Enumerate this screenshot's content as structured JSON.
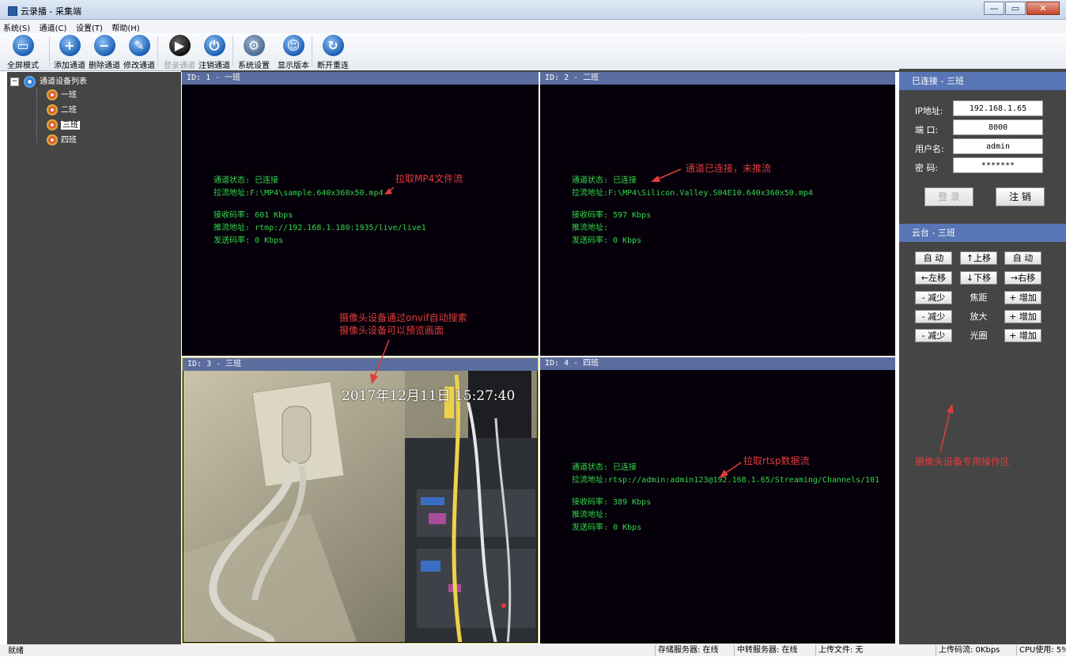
{
  "window": {
    "title": "云录播 - 采集端",
    "buttons": {
      "minimize": "—",
      "maximize": "▭",
      "close": "✕"
    }
  },
  "menu": [
    "系统(S)",
    "通道(C)",
    "设置(T)",
    "帮助(H)"
  ],
  "toolbar": [
    {
      "label": "全屏模式",
      "icon": "monitor-icon",
      "enabled": true
    },
    {
      "label": "添加通道",
      "icon": "plus-circle-icon",
      "enabled": true
    },
    {
      "label": "删除通道",
      "icon": "minus-circle-icon",
      "enabled": true
    },
    {
      "label": "修改通道",
      "icon": "edit-circle-icon",
      "enabled": true
    },
    {
      "label": "登录通道",
      "icon": "play-circle-icon",
      "enabled": false
    },
    {
      "label": "注销通道",
      "icon": "power-icon",
      "enabled": true
    },
    {
      "label": "系统设置",
      "icon": "gear-icon",
      "enabled": true
    },
    {
      "label": "显示版本",
      "icon": "user-icon",
      "enabled": true
    },
    {
      "label": "断开重连",
      "icon": "refresh-icon",
      "enabled": true
    }
  ],
  "tree": {
    "root_expander": "−",
    "root": "通道设备列表",
    "items": [
      "一班",
      "二班",
      "三班",
      "四班"
    ],
    "selected_index": 2
  },
  "panels": [
    {
      "header": "ID: 1 - 一班",
      "status_label": "通道状态:",
      "status": "已连接",
      "pull_label": "拉流地址:",
      "pull": "F:\\MP4\\sample.640x360x50.mp4",
      "recv_label": "接收码率:",
      "recv": "601 Kbps",
      "push_label": "推流地址:",
      "push": "rtmp://192.168.1.180:1935/live/live1",
      "send_label": "发送码率:",
      "send": "0 Kbps"
    },
    {
      "header": "ID: 2 - 二班",
      "status_label": "通道状态:",
      "status": "已连接",
      "pull_label": "拉流地址:",
      "pull": "F:\\MP4\\Silicon.Valley.S04E10.640x360x50.mp4",
      "recv_label": "接收码率:",
      "recv": "597 Kbps",
      "push_label": "推流地址:",
      "push": "",
      "send_label": "发送码率:",
      "send": "0 Kbps"
    },
    {
      "header": "ID: 3 - 三班",
      "timestamp": "2017年12月11日 15:27:40"
    },
    {
      "header": "ID: 4 - 四班",
      "status_label": "通道状态:",
      "status": "已连接",
      "pull_label": "拉流地址:",
      "pull": "rtsp://admin:admin123@192.168.1.65/Streaming/Channels/101",
      "recv_label": "接收码率:",
      "recv": "389 Kbps",
      "push_label": "推流地址:",
      "push": "",
      "send_label": "发送码率:",
      "send": "0 Kbps"
    }
  ],
  "annotations": {
    "mp4": "拉取MP4文件流",
    "connected": "通道已连接，未推流",
    "onvif_line1": "摄像头设备通过onvif自动搜索",
    "onvif_line2": "摄像头设备可以预览画面",
    "rtsp": "拉取rtsp数据流",
    "ptz_area": "摄像头设备专用操作区"
  },
  "connection": {
    "header": "已连接 - 三班",
    "ip_label": "IP地址:",
    "ip": "192.168.1.65",
    "port_label": "端  口:",
    "port": "8000",
    "user_label": "用户名:",
    "user": "admin",
    "pass_label": "密  码:",
    "pass": "*******",
    "login": "登 录",
    "logout": "注 销"
  },
  "ptz": {
    "header": "云台 - 三班",
    "auto_left": "自 动",
    "up": "↑上移",
    "auto_right": "自 动",
    "left": "←左移",
    "down": "↓下移",
    "right": "→右移",
    "focus_minus": "- 减少",
    "focus_label": "焦距",
    "focus_plus": "+ 增加",
    "zoom_minus": "- 减少",
    "zoom_label": "放大",
    "zoom_plus": "+ 增加",
    "iris_minus": "- 减少",
    "iris_label": "光圈",
    "iris_plus": "+ 增加"
  },
  "statusbar": {
    "ready": "就绪",
    "storage": "存储服务器: 在线",
    "relay": "中转服务器: 在线",
    "upload_file": "上传文件: 无",
    "upload_rate": "上传码流: 0Kbps",
    "cpu": "CPU使用: 5%"
  },
  "colors": {
    "panel_header": "#5b6c9e",
    "info_text": "#32d74b",
    "annotation": "#e23c3c",
    "right_header": "#5875b5"
  }
}
